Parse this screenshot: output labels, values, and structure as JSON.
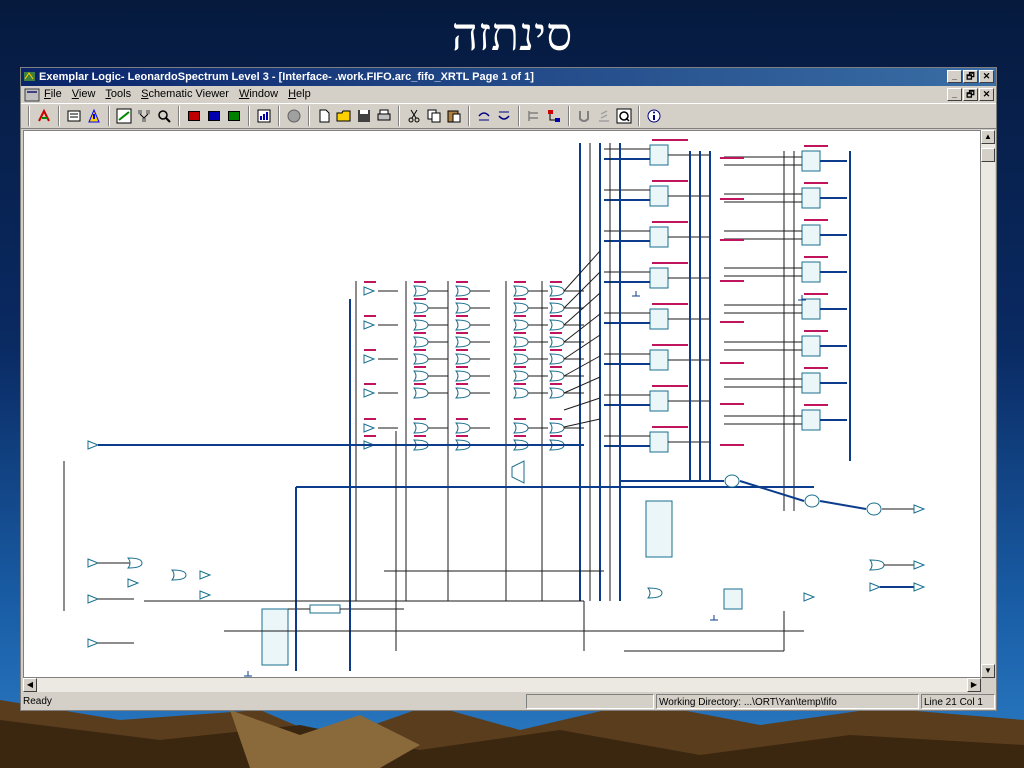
{
  "slide": {
    "title": "סינתזה"
  },
  "window": {
    "title": "Exemplar Logic- LeonardoSpectrum Level 3 - [Interface- .work.FIFO.arc_fifo_XRTL Page 1 of 1]",
    "controls": [
      "_",
      "🗗",
      "✕"
    ]
  },
  "menu": {
    "items": [
      {
        "label": "File",
        "key": "F",
        "rest": "ile"
      },
      {
        "label": "View",
        "key": "V",
        "rest": "iew"
      },
      {
        "label": "Tools",
        "key": "T",
        "rest": "ools"
      },
      {
        "label": "Schematic Viewer",
        "key": "S",
        "rest": "chematic Viewer"
      },
      {
        "label": "Window",
        "key": "W",
        "rest": "indow"
      },
      {
        "label": "Help",
        "key": "H",
        "rest": "elp"
      }
    ]
  },
  "toolbar": {
    "icons": [
      "run-wizard-icon",
      "constraints-icon",
      "analyze-icon",
      "rtl-schematic-icon",
      "hierarchy-icon",
      "zoom-icon",
      "synth-red-icon",
      "synth-blue-icon",
      "synth-green-icon",
      "report-icon",
      "stop-icon",
      "new-file-icon",
      "open-file-icon",
      "save-icon",
      "print-icon",
      "cut-icon",
      "copy-icon",
      "paste-icon",
      "undo-icon",
      "redo-icon",
      "pin-icon",
      "tree-icon",
      "u-icon",
      "step-icon",
      "q-icon",
      "info-icon"
    ]
  },
  "status": {
    "ready": "Ready",
    "working_directory": "Working Directory: ...\\ORT\\Yan\\temp\\fifo",
    "position": "Line 21 Col 1"
  },
  "colors": {
    "wire": "#1a1a1a",
    "bus": "#0b3d8c",
    "cell": "#1a6f8f",
    "cell_fill": "#eaf6f8",
    "label": "#c0145c"
  }
}
